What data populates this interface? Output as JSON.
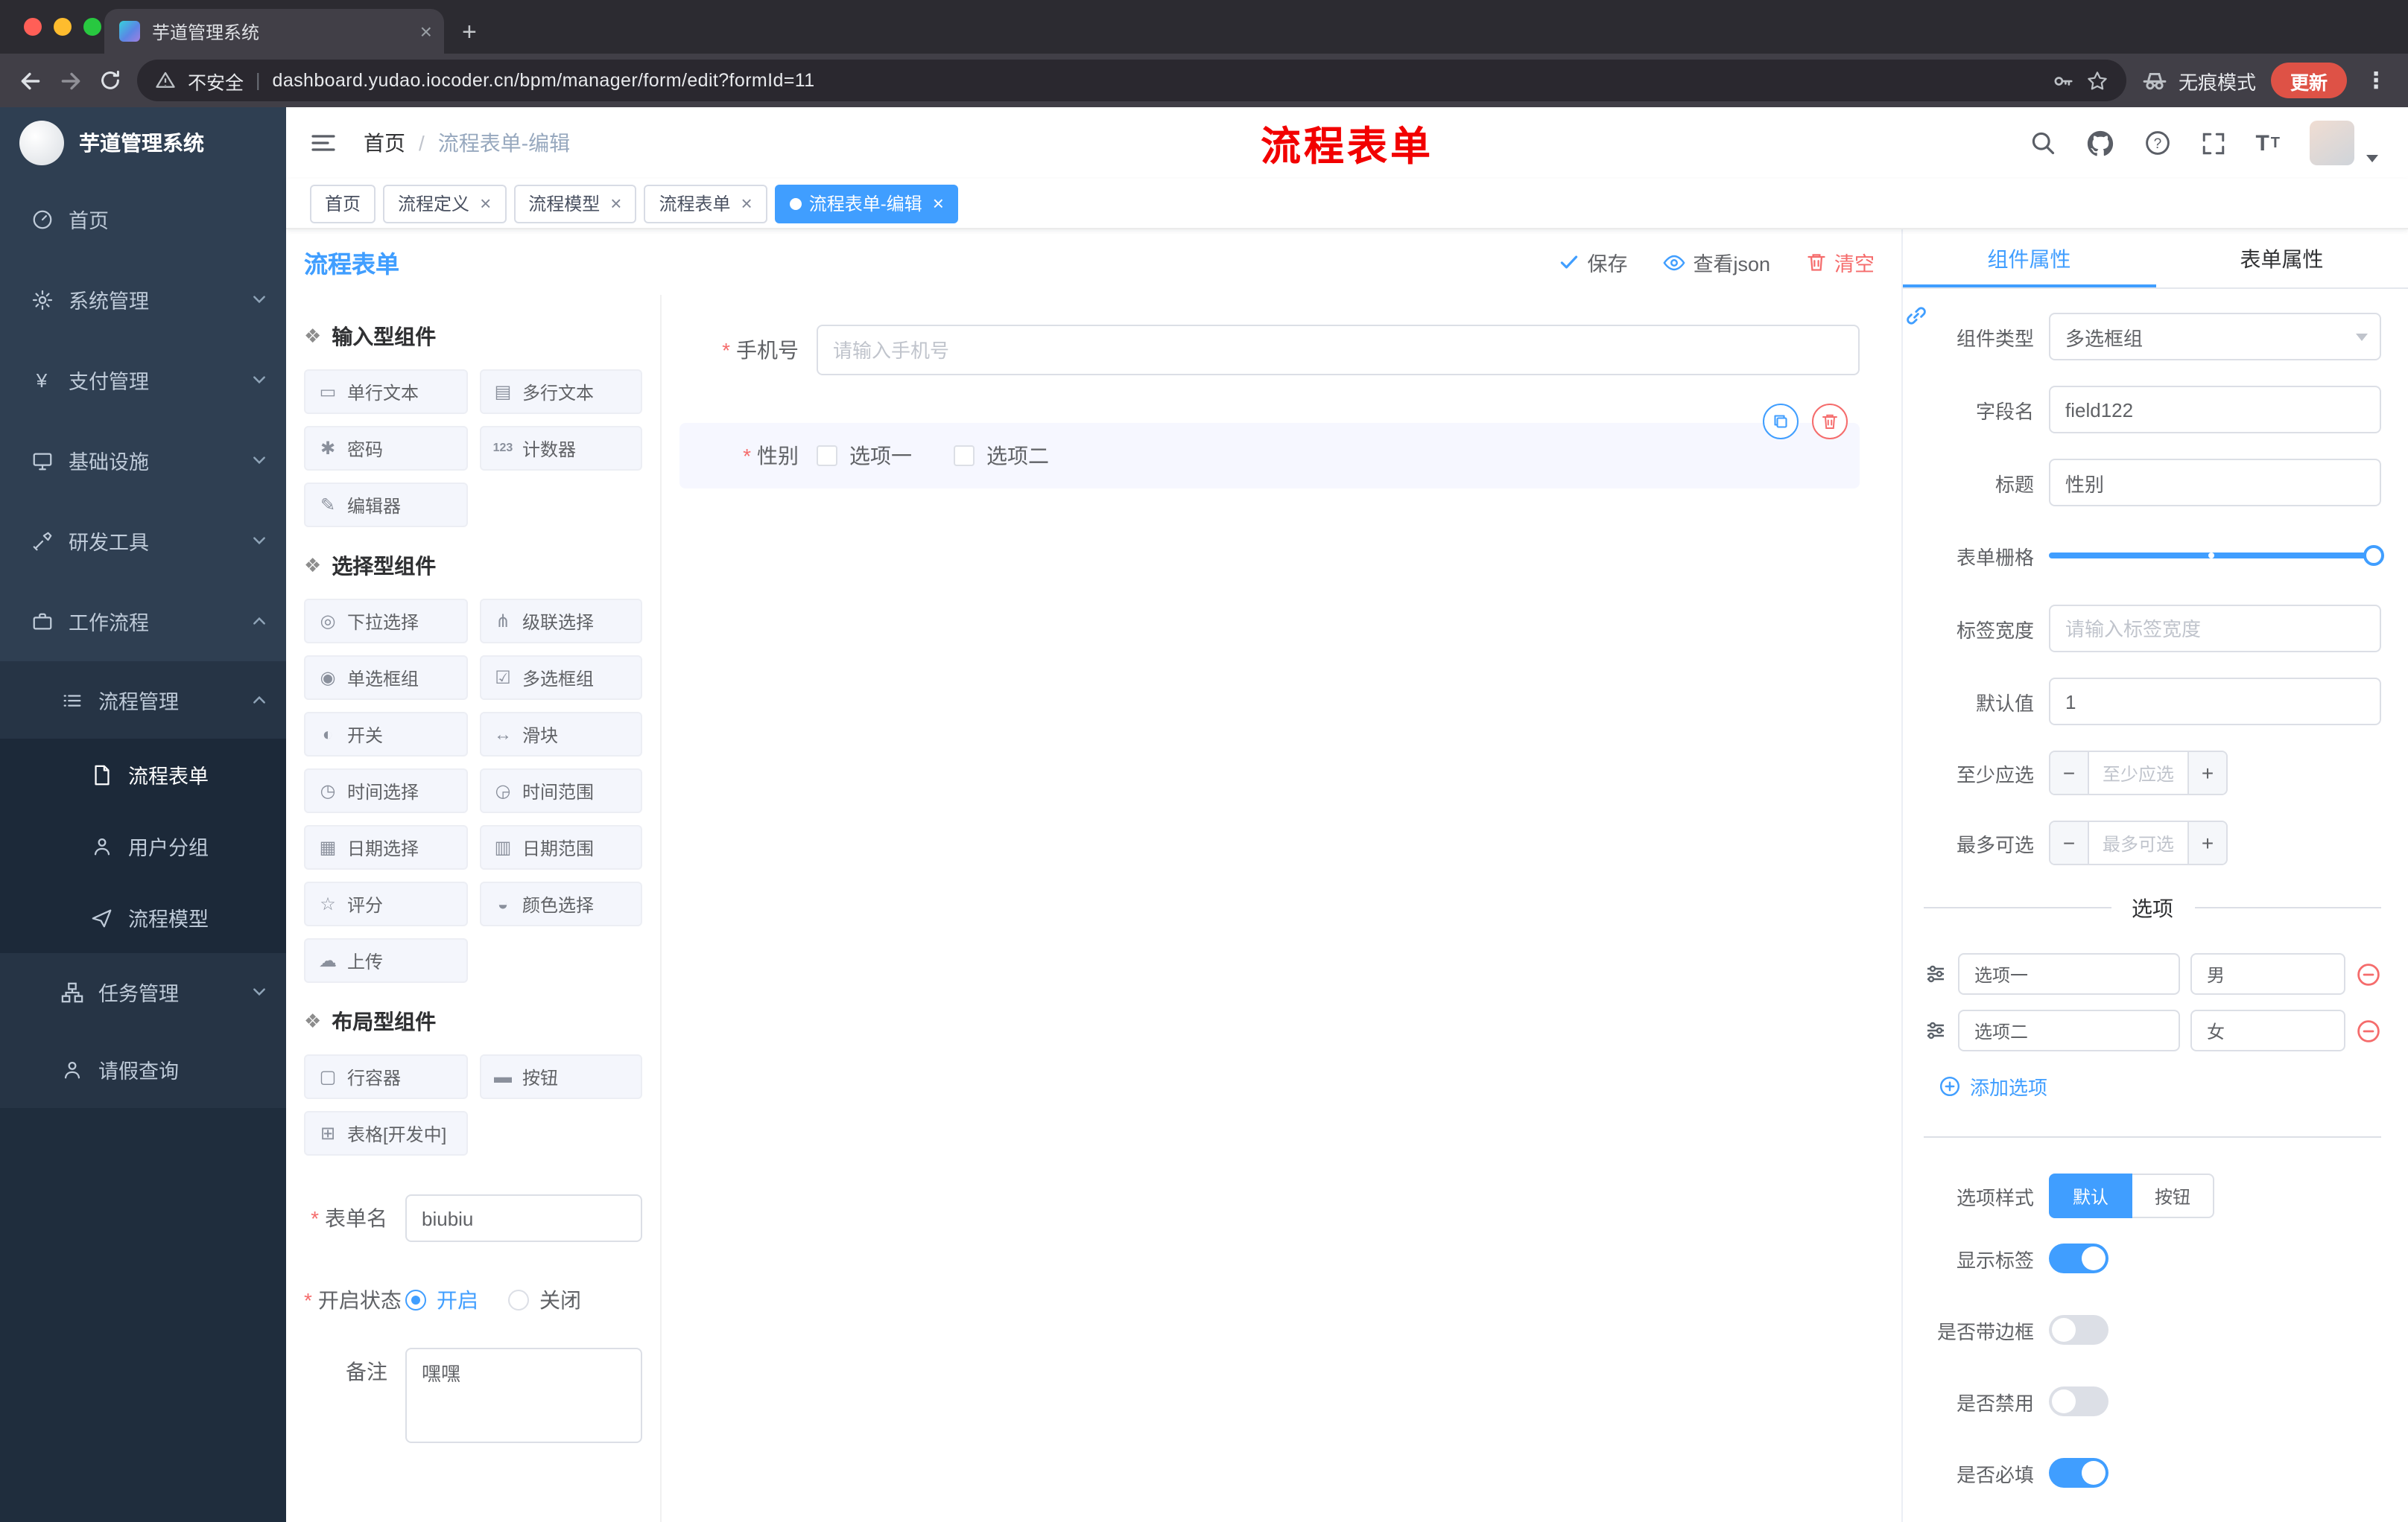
{
  "theme": {
    "primary": "#409eff",
    "danger": "#f56c6c",
    "annotation_red": "#f20000"
  },
  "browser": {
    "tab_title": "芋道管理系统",
    "security_label": "不安全",
    "url_separator": "|",
    "url": "dashboard.yudao.iocoder.cn/bpm/manager/form/edit?formId=11",
    "incognito_label": "无痕模式",
    "update_label": "更新"
  },
  "sidebar": {
    "logo_title": "芋道管理系统",
    "items": [
      {
        "label": "首页",
        "icon": "dashboard-icon"
      },
      {
        "label": "系统管理",
        "icon": "gear-icon",
        "chevron": "down"
      },
      {
        "label": "支付管理",
        "icon": "yen-icon",
        "chevron": "down"
      },
      {
        "label": "基础设施",
        "icon": "monitor-icon",
        "chevron": "down"
      },
      {
        "label": "研发工具",
        "icon": "tools-icon",
        "chevron": "down"
      },
      {
        "label": "工作流程",
        "icon": "briefcase-icon",
        "chevron": "up"
      },
      {
        "label": "流程管理",
        "icon": "list-icon",
        "chevron": "up"
      },
      {
        "label": "流程表单",
        "icon": "form-icon",
        "active": true
      },
      {
        "label": "用户分组",
        "icon": "users-icon"
      },
      {
        "label": "流程模型",
        "icon": "send-icon"
      },
      {
        "label": "任务管理",
        "icon": "tree-icon",
        "chevron": "down"
      },
      {
        "label": "请假查询",
        "icon": "user-icon"
      }
    ]
  },
  "header": {
    "breadcrumb_root": "首页",
    "breadcrumb_separator": "/",
    "breadcrumb_current": "流程表单-编辑",
    "overlay_title": "流程表单"
  },
  "tags": [
    {
      "label": "首页",
      "closable": false,
      "active": false
    },
    {
      "label": "流程定义",
      "closable": true,
      "active": false
    },
    {
      "label": "流程模型",
      "closable": true,
      "active": false
    },
    {
      "label": "流程表单",
      "closable": true,
      "active": false
    },
    {
      "label": "流程表单-编辑",
      "closable": true,
      "active": true
    }
  ],
  "designer": {
    "panel_title": "流程表单",
    "actions": {
      "save": "保存",
      "view_json": "查看json",
      "clear": "清空"
    },
    "palette_sections": [
      {
        "title": "输入型组件",
        "items": [
          {
            "label": "单行文本",
            "icon": "single-line-icon"
          },
          {
            "label": "多行文本",
            "icon": "multi-line-icon"
          },
          {
            "label": "密码",
            "icon": "password-icon"
          },
          {
            "label": "计数器",
            "icon": "counter-icon"
          },
          {
            "label": "编辑器",
            "icon": "editor-icon"
          }
        ]
      },
      {
        "title": "选择型组件",
        "items": [
          {
            "label": "下拉选择",
            "icon": "select-icon"
          },
          {
            "label": "级联选择",
            "icon": "cascader-icon"
          },
          {
            "label": "单选框组",
            "icon": "radio-group-icon"
          },
          {
            "label": "多选框组",
            "icon": "checkbox-group-icon"
          },
          {
            "label": "开关",
            "icon": "switch-icon"
          },
          {
            "label": "滑块",
            "icon": "slider-icon"
          },
          {
            "label": "时间选择",
            "icon": "time-picker-icon"
          },
          {
            "label": "时间范围",
            "icon": "time-range-icon"
          },
          {
            "label": "日期选择",
            "icon": "date-picker-icon"
          },
          {
            "label": "日期范围",
            "icon": "date-range-icon"
          },
          {
            "label": "评分",
            "icon": "rate-icon"
          },
          {
            "label": "颜色选择",
            "icon": "color-picker-icon"
          },
          {
            "label": "上传",
            "icon": "upload-icon"
          }
        ]
      },
      {
        "title": "布局型组件",
        "items": [
          {
            "label": "行容器",
            "icon": "row-container-icon"
          },
          {
            "label": "按钮",
            "icon": "button-icon"
          },
          {
            "label": "表格[开发中]",
            "icon": "table-icon"
          }
        ]
      }
    ],
    "form_meta": {
      "name_label": "表单名",
      "name_value": "biubiu",
      "status_label": "开启状态",
      "status_on": "开启",
      "status_off": "关闭",
      "status_selected": "开启",
      "remark_label": "备注",
      "remark_value": "嘿嘿"
    },
    "canvas": {
      "phone_label": "手机号",
      "phone_placeholder": "请输入手机号",
      "gender_label": "性别",
      "gender_options": [
        "选项一",
        "选项二"
      ]
    }
  },
  "properties": {
    "tab_component": "组件属性",
    "tab_form": "表单属性",
    "active_tab": "组件属性",
    "component_type_label": "组件类型",
    "component_type_value": "多选框组",
    "field_name_label": "字段名",
    "field_name_value": "field122",
    "title_label": "标题",
    "title_value": "性别",
    "grid_label": "表单栅格",
    "label_width_label": "标签宽度",
    "label_width_placeholder": "请输入标签宽度",
    "default_label": "默认值",
    "default_value": "1",
    "min_label": "至少应选",
    "min_placeholder": "至少应选",
    "max_label": "最多可选",
    "max_placeholder": "最多可选",
    "options_title": "选项",
    "options": [
      {
        "label": "选项一",
        "value": "男"
      },
      {
        "label": "选项二",
        "value": "女"
      }
    ],
    "add_option_label": "添加选项",
    "option_style_label": "选项样式",
    "option_style_default": "默认",
    "option_style_button": "按钮",
    "option_style_selected": "默认",
    "show_label": {
      "label": "显示标签",
      "on": true
    },
    "with_border": {
      "label": "是否带边框",
      "on": false
    },
    "disabled": {
      "label": "是否禁用",
      "on": false
    },
    "required": {
      "label": "是否必填",
      "on": true
    }
  }
}
